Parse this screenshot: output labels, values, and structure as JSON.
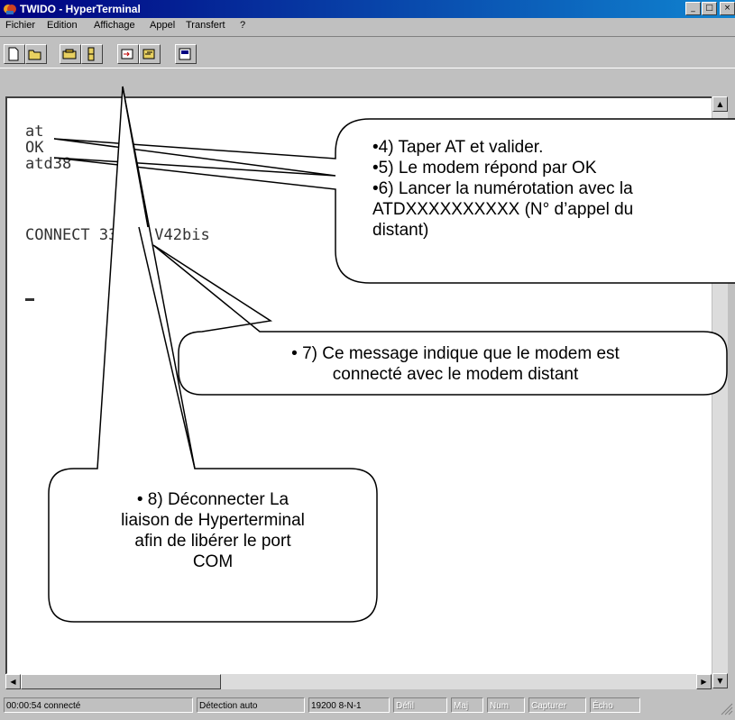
{
  "window": {
    "title": "TWIDO - HyperTerminal",
    "controls": {
      "minimize": "_",
      "maximize": "□",
      "close": "×"
    }
  },
  "menu": [
    "Fichier",
    "Edition",
    "Affichage",
    "Appel",
    "Transfert",
    "?"
  ],
  "toolbar": {
    "buttons": [
      "new-icon",
      "open-icon",
      "connect-icon",
      "disconnect-icon",
      "send-icon",
      "receive-icon",
      "properties-icon"
    ]
  },
  "terminal": {
    "lines": [
      "at",
      "OK",
      "atd38",
      "",
      "CONNECT 33600 V42bis"
    ]
  },
  "callouts": {
    "steps": {
      "line1": "•4) Taper AT et valider.",
      "line2": "•5) Le modem répond par OK",
      "line3": "•6) Lancer la numérotation avec la",
      "line4": "ATDXXXXXXXXXX (N° d’appel du",
      "line5": "distant)"
    },
    "connect_msg": {
      "line1": "• 7) Ce message indique que le modem est",
      "line2": "connecté avec le modem distant"
    },
    "disconnect": {
      "line1": "• 8) Déconnecter La",
      "line2": "liaison de Hyperterminal",
      "line3": "afin de libérer le port",
      "line4": "COM"
    }
  },
  "statusbar": {
    "cells": [
      "00:00:54 connecté",
      "Détection auto",
      "19200 8-N-1",
      "Défil",
      "Maj",
      "Num",
      "Capturer",
      "Écho"
    ]
  },
  "colors": {
    "title_start": "#000080",
    "title_end": "#1084d0",
    "window_bg": "#c0c0c0",
    "terminal_bg": "#ffffff"
  }
}
